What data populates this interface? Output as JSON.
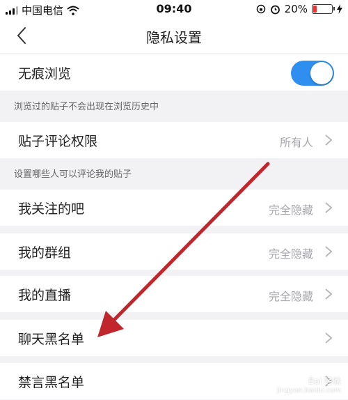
{
  "status": {
    "carrier": "中国电信",
    "time": "09:40",
    "battery": "20%",
    "battery_level": 0.2
  },
  "nav": {
    "title": "隐私设置"
  },
  "rows": {
    "incognito": {
      "label": "无痕浏览",
      "enabled": true
    },
    "incognito_hint": "浏览过的贴子不会出现在浏览历史中",
    "comment_permission": {
      "label": "贴子评论权限",
      "value": "所有人"
    },
    "comment_hint": "设置哪些人可以评论我的贴子",
    "followed_bars": {
      "label": "我关注的吧",
      "value": "完全隐藏"
    },
    "my_groups": {
      "label": "我的群组",
      "value": "完全隐藏"
    },
    "my_live": {
      "label": "我的直播",
      "value": "完全隐藏"
    },
    "chat_blacklist": {
      "label": "聊天黑名单"
    },
    "mute_blacklist": {
      "label": "禁言黑名单"
    }
  },
  "colors": {
    "accent": "#2e8ff0",
    "annotation_arrow": "#c0262c"
  },
  "icons": [
    "back-chevron-icon",
    "chevron-right-icon",
    "wifi-icon",
    "alarm-icon",
    "battery-icon"
  ],
  "watermark": {
    "brand": "Bai 经验",
    "url": "jingyan.baidu.com"
  }
}
